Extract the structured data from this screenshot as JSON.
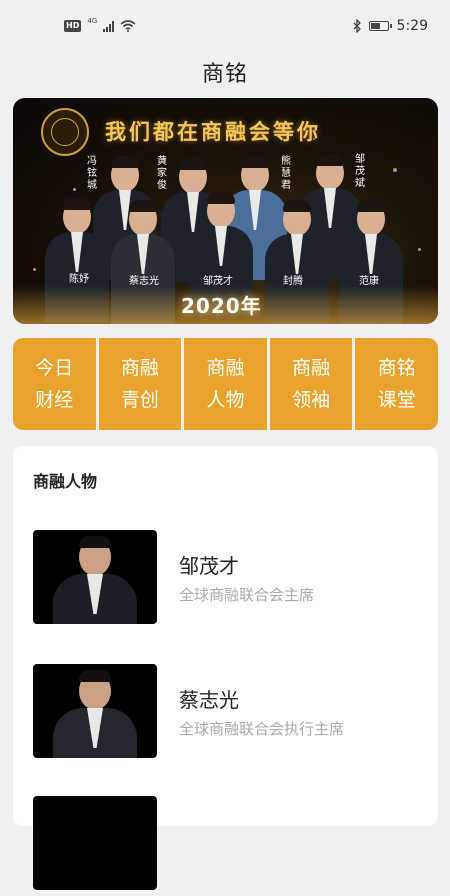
{
  "status_bar": {
    "hd": "HD",
    "network": "4G",
    "time": "5:29"
  },
  "header": {
    "title": "商铭"
  },
  "banner": {
    "slogan": "我们都在商融会等你",
    "year": "2020年",
    "names_vertical": [
      "冯铉城",
      "黄家俊",
      "熊慧君",
      "邹茂斌"
    ],
    "names_horizontal": [
      "陈妤",
      "蔡志光",
      "邹茂才",
      "封腾",
      "范康"
    ]
  },
  "categories": [
    {
      "line1": "今日",
      "line2": "财经"
    },
    {
      "line1": "商融",
      "line2": "青创"
    },
    {
      "line1": "商融",
      "line2": "人物"
    },
    {
      "line1": "商融",
      "line2": "领袖"
    },
    {
      "line1": "商铭",
      "line2": "课堂"
    }
  ],
  "section": {
    "title": "商融人物",
    "items": [
      {
        "name": "邹茂才",
        "title": "全球商融联合会主席"
      },
      {
        "name": "蔡志光",
        "title": "全球商融联合会执行主席"
      }
    ]
  },
  "colors": {
    "accent": "#e9a32d",
    "background": "#f0f0f0"
  }
}
